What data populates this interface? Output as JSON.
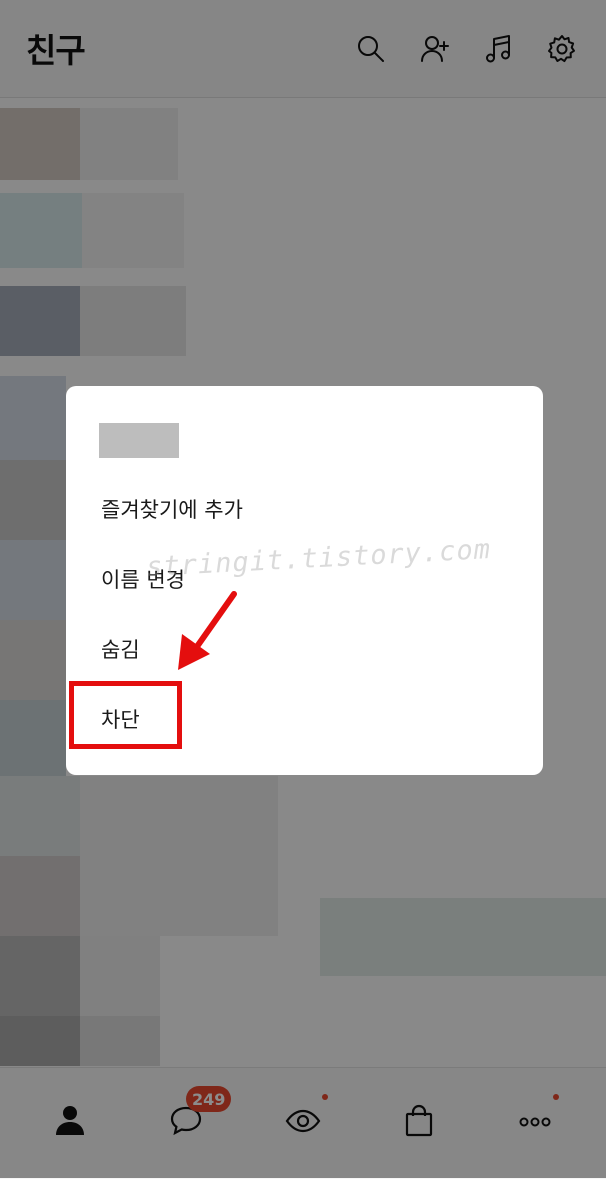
{
  "header": {
    "title": "친구",
    "icons": [
      "search-icon",
      "add-friend-icon",
      "music-icon",
      "settings-icon"
    ]
  },
  "dialog": {
    "items": [
      {
        "label": "즐겨찾기에 추가"
      },
      {
        "label": "이름 변경"
      },
      {
        "label": "숨김"
      },
      {
        "label": "차단"
      }
    ]
  },
  "watermark": "stringit.tistory.com",
  "bottom_nav": {
    "items": [
      "friends-icon",
      "chat-icon",
      "view-icon",
      "shopping-icon",
      "more-icon"
    ],
    "chat_badge": "249"
  },
  "colors": {
    "highlight": "#e40e0e",
    "badge": "#e8482f"
  }
}
